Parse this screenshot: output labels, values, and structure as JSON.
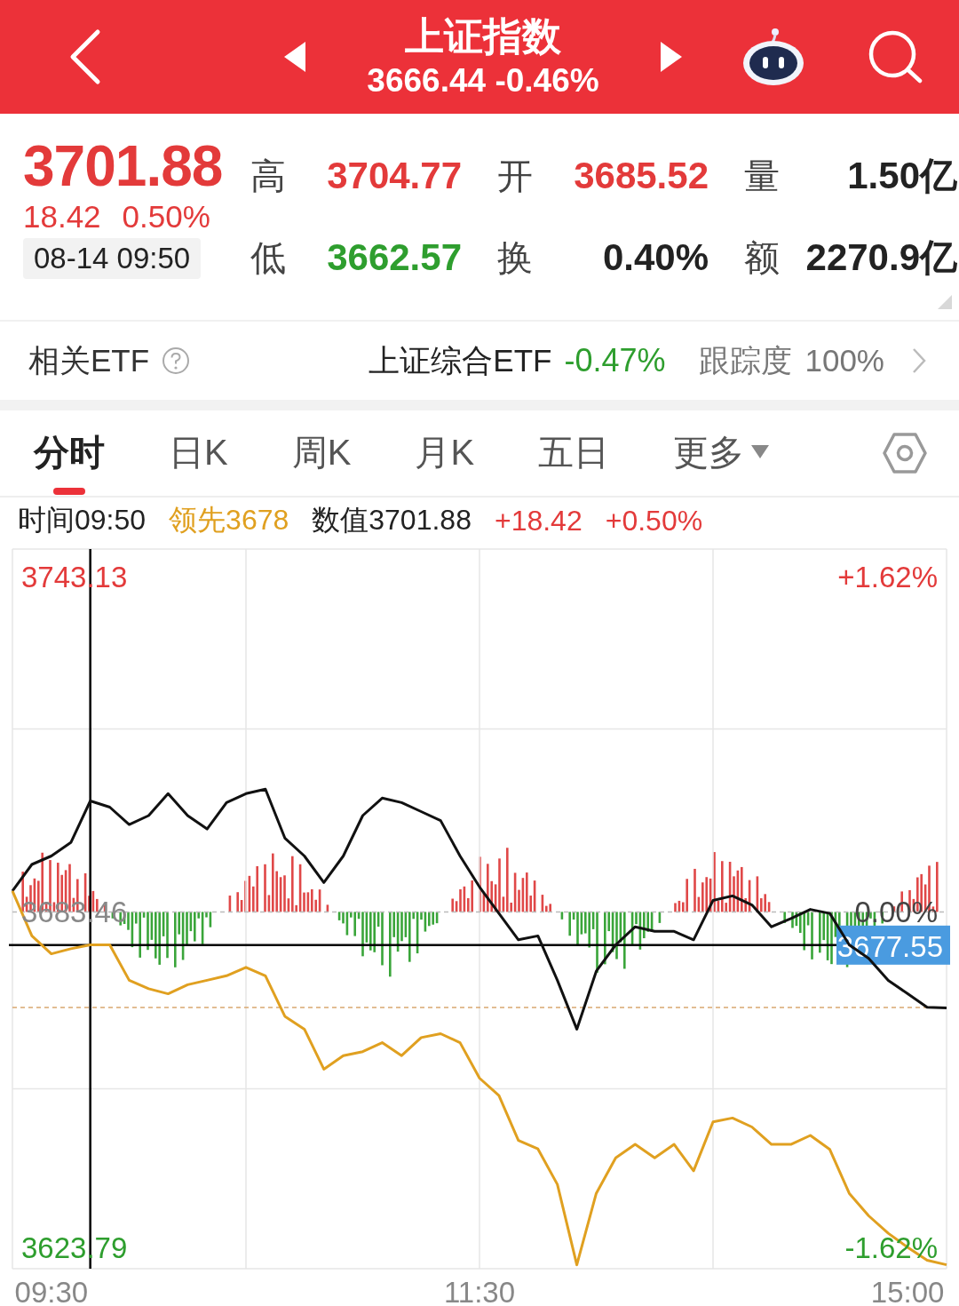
{
  "header": {
    "title": "上证指数",
    "subtitle": "3666.44 -0.46%"
  },
  "quote": {
    "price": "3701.88",
    "change": "18.42",
    "change_pct": "0.50%",
    "datetime": "08-14 09:50",
    "stats": [
      {
        "label": "高",
        "value": "3704.77",
        "color": "#e33a3a"
      },
      {
        "label": "开",
        "value": "3685.52",
        "color": "#e33a3a"
      },
      {
        "label": "量",
        "value": "1.50亿",
        "color": "#222222"
      },
      {
        "label": "低",
        "value": "3662.57",
        "color": "#2e9e2e"
      },
      {
        "label": "换",
        "value": "0.40%",
        "color": "#222222"
      },
      {
        "label": "额",
        "value": "2270.9亿",
        "color": "#222222"
      }
    ]
  },
  "etf": {
    "label": "相关ETF",
    "name": "上证综合ETF",
    "change": "-0.47%",
    "tracking_label": "跟踪度",
    "tracking": "100%"
  },
  "tabs": [
    {
      "label": "分时",
      "selected": true
    },
    {
      "label": "日K",
      "selected": false
    },
    {
      "label": "周K",
      "selected": false
    },
    {
      "label": "月K",
      "selected": false
    },
    {
      "label": "五日",
      "selected": false
    },
    {
      "label": "更多",
      "selected": false,
      "kind": "dropdown"
    }
  ],
  "info": [
    {
      "text": "时间09:50",
      "color": "#222222"
    },
    {
      "text": "领先3678",
      "color": "#e0a020"
    },
    {
      "text": "数值3701.88",
      "color": "#222222"
    },
    {
      "text": "+18.42",
      "color": "#e33a3a"
    },
    {
      "text": "+0.50%",
      "color": "#e33a3a"
    }
  ],
  "chart": {
    "right_labels": [
      "+1.62%",
      "0.00%",
      "-1.62%"
    ],
    "chart_data": {
      "type": "line",
      "categories": [
        null,
        null,
        "09:30",
        null,
        null,
        null,
        null,
        null,
        null,
        null,
        null,
        null,
        null,
        null,
        null,
        null,
        null,
        null,
        null,
        null,
        null,
        null,
        null,
        null,
        "11:30",
        null,
        null,
        null,
        null,
        null,
        null,
        null,
        null,
        null,
        null,
        null,
        null,
        null,
        null,
        null,
        null,
        null,
        null,
        null,
        null,
        null,
        "15:00",
        null,
        null
      ],
      "series": [
        {
          "color": "#111111",
          "values": [
            3687.2,
            3691.9,
            3693.4,
            3695.8,
            3703.2,
            3702.1,
            3699.0,
            3700.6,
            3704.5,
            3700.6,
            3698.2,
            3702.9,
            3704.5,
            3705.3,
            3696.6,
            3693.4,
            3688.7,
            3693.4,
            3700.6,
            3703.7,
            3702.9,
            3701.3,
            3699.7,
            3693.4,
            3687.9,
            3683.2,
            3678.5,
            3679.2,
            3671.3,
            3662.6,
            3672.9,
            3677.6,
            3680.8,
            3680.0,
            3680.0,
            3678.5,
            3685.5,
            3686.3,
            3684.7,
            3680.8,
            3682.3,
            3683.9,
            3683.2,
            3677.6,
            3675.2,
            3671.3,
            3668.9,
            3666.5,
            3666.4
          ]
        },
        {
          "color": "#e0a020",
          "values": [
            3687.2,
            3679.2,
            3676.0,
            3676.9,
            3677.6,
            3677.6,
            3671.3,
            3669.8,
            3668.9,
            3670.5,
            3671.3,
            3672.1,
            3673.6,
            3672.1,
            3664.9,
            3662.6,
            3655.5,
            3657.9,
            3658.6,
            3660.2,
            3657.9,
            3661.1,
            3661.8,
            3660.2,
            3653.9,
            3650.8,
            3642.8,
            3641.3,
            3635.0,
            3620.7,
            3633.4,
            3639.7,
            3642.1,
            3639.7,
            3642.1,
            3637.4,
            3646.1,
            3646.8,
            3645.2,
            3642.1,
            3642.1,
            3643.7,
            3641.2,
            3633.4,
            3629.4,
            3626.3,
            3623.8,
            3621.5,
            3620.7
          ]
        }
      ],
      "grid": true,
      "ylim": [
        3620,
        3748
      ],
      "yticks": [
        {
          "value": 3743.13,
          "label": "3743.13"
        },
        {
          "value": 3683.46,
          "label": "3683.46"
        },
        {
          "value": 3623.79,
          "label": "3623.79"
        }
      ],
      "ref_lines": [
        {
          "axis": "y",
          "value": 3683.46,
          "color": "#bbbbbb"
        },
        {
          "axis": "y",
          "value": 3666.44,
          "color": "#d9a870"
        },
        {
          "axis": "y",
          "value": 3677.55,
          "color": "#000000"
        }
      ],
      "annotations": [
        "3677.55"
      ]
    }
  }
}
